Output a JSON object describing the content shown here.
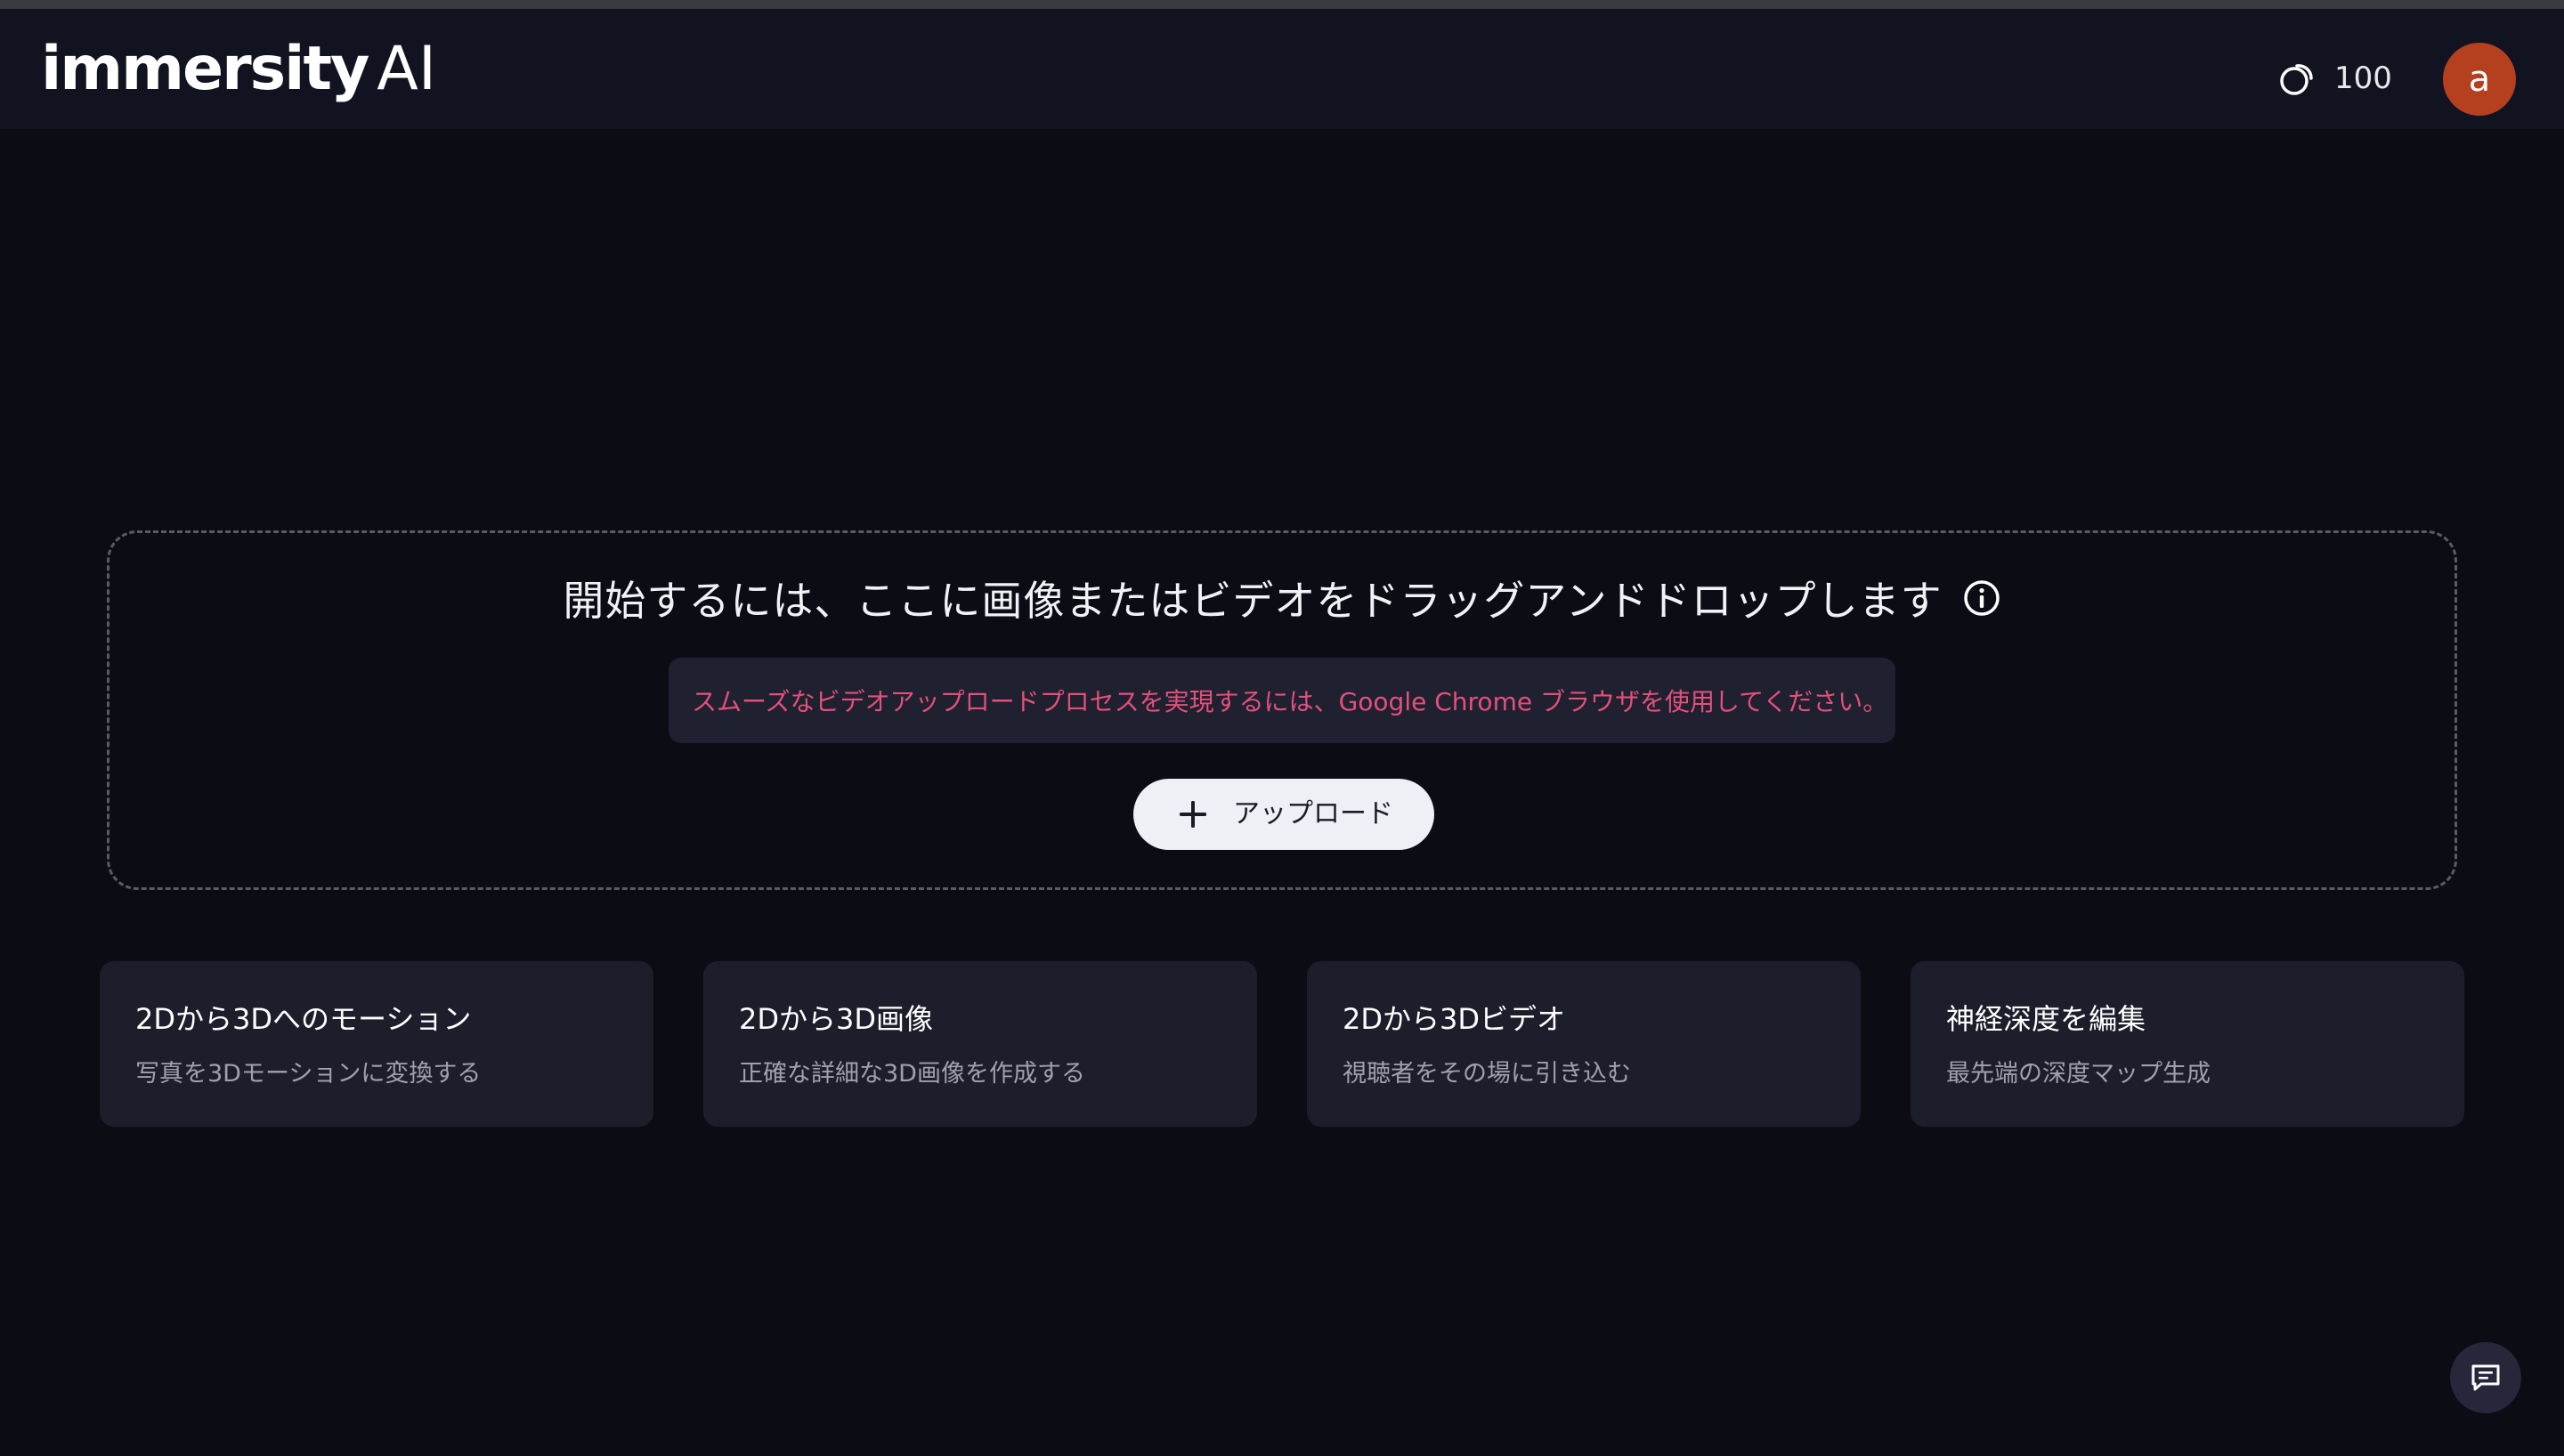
{
  "header": {
    "logo_word": "immersity",
    "logo_ai": "AI",
    "credits_count": "100",
    "avatar_letter": "a"
  },
  "dropzone": {
    "title": "開始するには、ここに画像またはビデオをドラッグアンドドロップします",
    "notice": "スムーズなビデオアップロードプロセスを実現するには、Google Chrome ブラウザを使用してください。",
    "upload_label": "アップロード"
  },
  "cards": [
    {
      "title": "2Dから3Dへのモーション",
      "subtitle": "写真を3Dモーションに変換する"
    },
    {
      "title": "2Dから3D画像",
      "subtitle": "正確な詳細な3D画像を作成する"
    },
    {
      "title": "2Dから3Dビデオ",
      "subtitle": "視聴者をその場に引き込む"
    },
    {
      "title": "神経深度を編集",
      "subtitle": "最先端の深度マップ生成"
    }
  ],
  "colors": {
    "background": "#0b0c14",
    "header": "#121320",
    "card": "#1d1e2c",
    "notice_text": "#e4507a",
    "avatar": "#b5401f"
  },
  "icons": {
    "credits": "coins-icon",
    "info": "info-icon",
    "upload": "plus-icon",
    "chat": "chat-icon"
  }
}
